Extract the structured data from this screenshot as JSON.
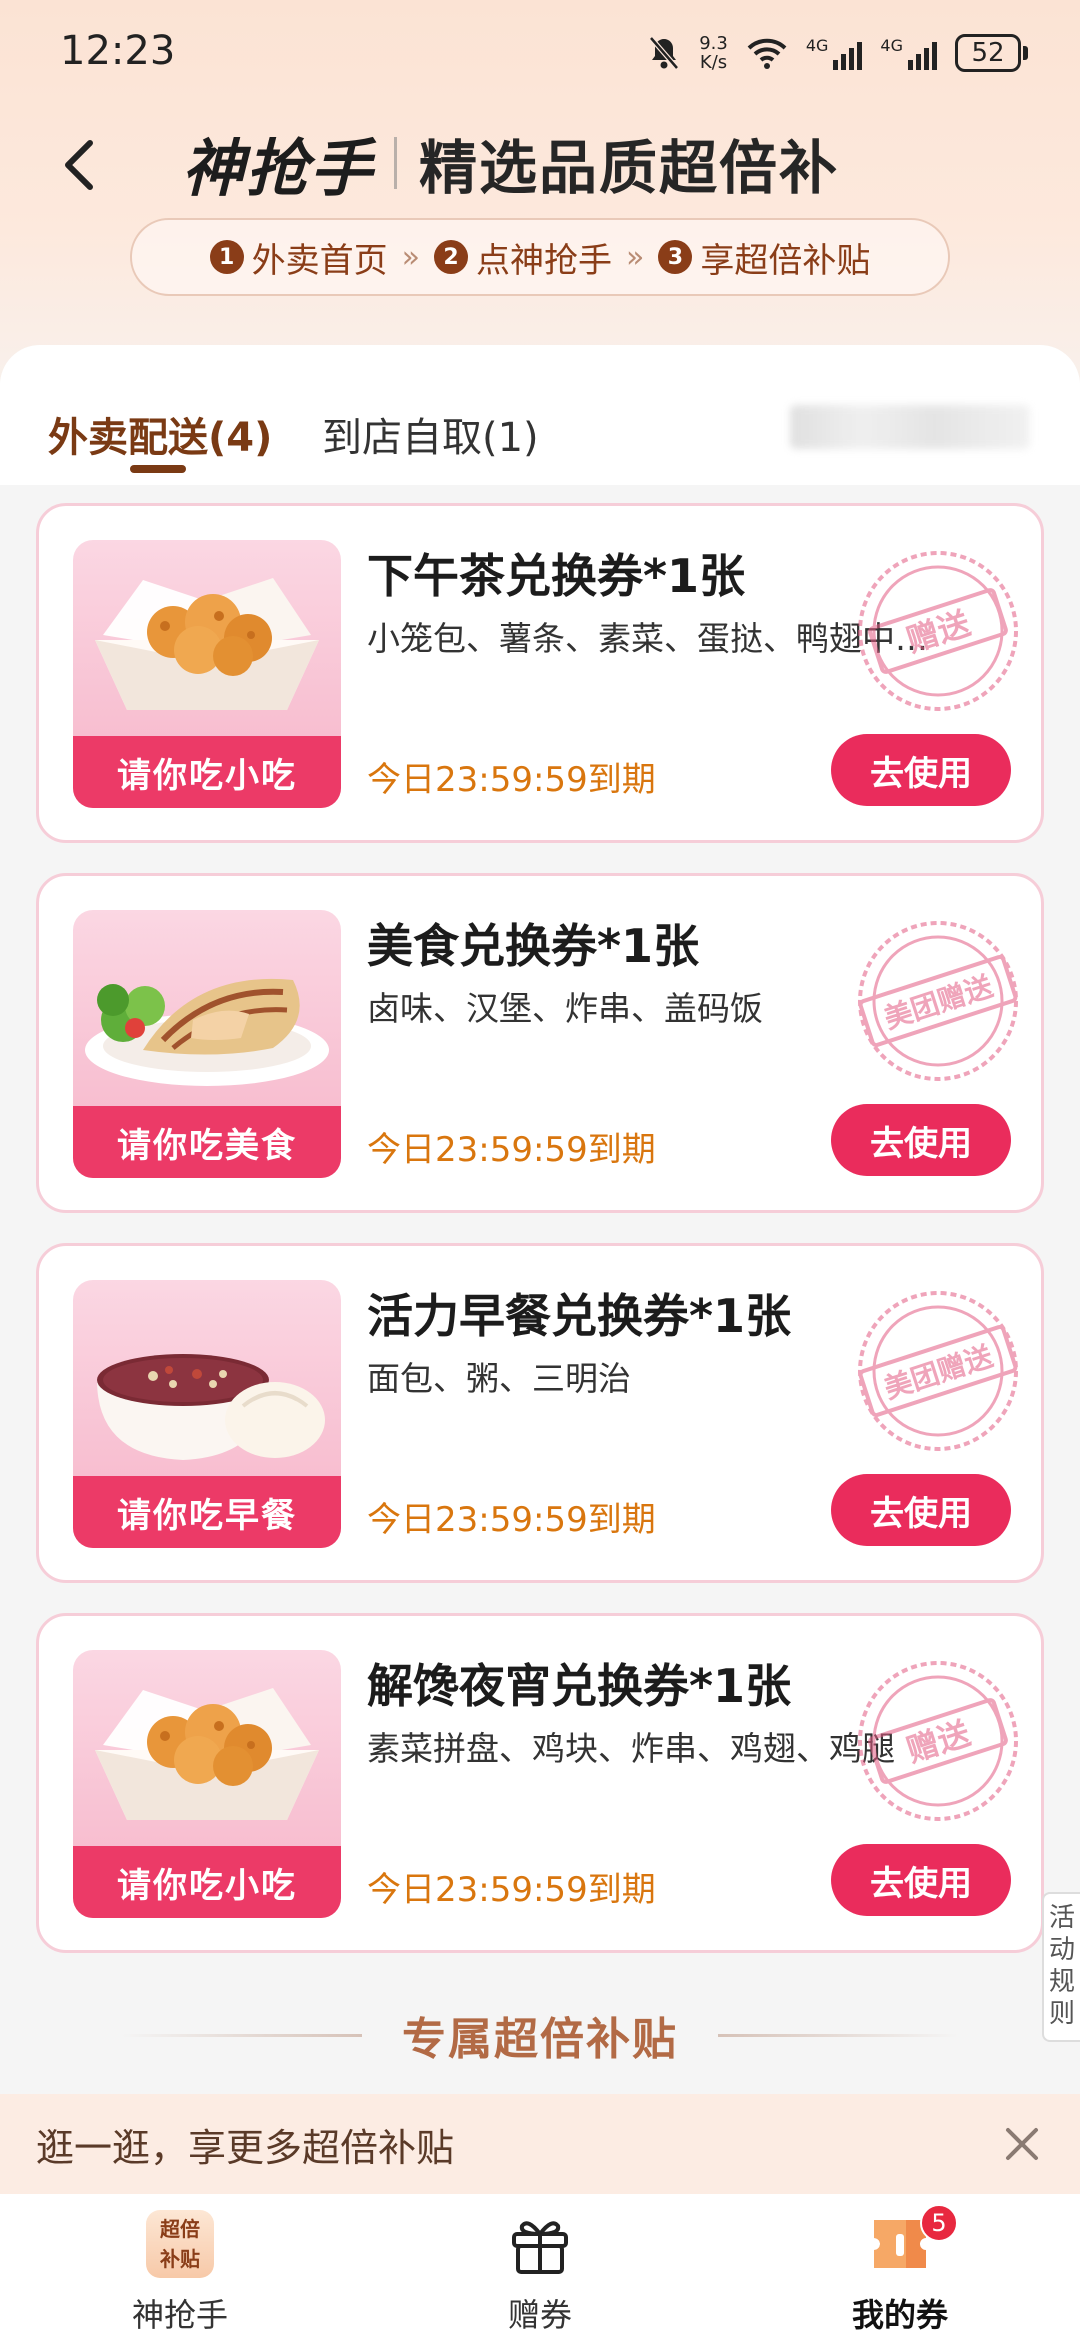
{
  "status_bar": {
    "time": "12:23",
    "speed_value": "9.3",
    "speed_unit": "K/s",
    "net1": "4G",
    "net2": "4G",
    "battery": "52"
  },
  "header": {
    "brand_logo": "神抢手",
    "slogan": "精选品质超倍补",
    "steps": [
      {
        "num": "1",
        "label": "外卖首页"
      },
      {
        "num": "2",
        "label": "点神抢手"
      },
      {
        "num": "3",
        "label": "享超倍补贴"
      }
    ],
    "step_separator": "»"
  },
  "tabs": [
    {
      "label": "外卖配送(4)",
      "active": true
    },
    {
      "label": "到店自取(1)",
      "active": false
    }
  ],
  "vouchers": [
    {
      "title": "下午茶兑换券*1张",
      "desc": "小笼包、薯条、素菜、蛋挞、鸭翅中…",
      "thumb_label": "请你吃小吃",
      "thumb_image": "fried-chicken",
      "expire": "今日23:59:59到期",
      "button": "去使用",
      "stamp": "赠送"
    },
    {
      "title": "美食兑换券*1张",
      "desc": "卤味、汉堡、炸串、盖码饭",
      "thumb_label": "请你吃美食",
      "thumb_image": "wrap",
      "expire": "今日23:59:59到期",
      "button": "去使用",
      "stamp": "美团赠送"
    },
    {
      "title": "活力早餐兑换券*1张",
      "desc": "面包、粥、三明治",
      "thumb_label": "请你吃早餐",
      "thumb_image": "porridge",
      "expire": "今日23:59:59到期",
      "button": "去使用",
      "stamp": "美团赠送"
    },
    {
      "title": "解馋夜宵兑换券*1张",
      "desc": "素菜拼盘、鸡块、炸串、鸡翅、鸡腿",
      "thumb_label": "请你吃小吃",
      "thumb_image": "fried-chicken",
      "expire": "今日23:59:59到期",
      "button": "去使用",
      "stamp": "赠送"
    }
  ],
  "side_tab": "活动规则",
  "section_title": "专属超倍补贴",
  "promo_bar": {
    "text": "逛一逛，享更多超倍补贴"
  },
  "bottom_nav": [
    {
      "label": "神抢手",
      "icon": "brand-icon",
      "icon_text": "超倍补贴"
    },
    {
      "label": "赠券",
      "icon": "gift-icon"
    },
    {
      "label": "我的券",
      "icon": "coupon-icon",
      "badge": "5",
      "active": true
    }
  ],
  "colors": {
    "accent": "#ea2c5c",
    "brand_brown": "#7a3a14",
    "expire_orange": "#d9760e"
  }
}
